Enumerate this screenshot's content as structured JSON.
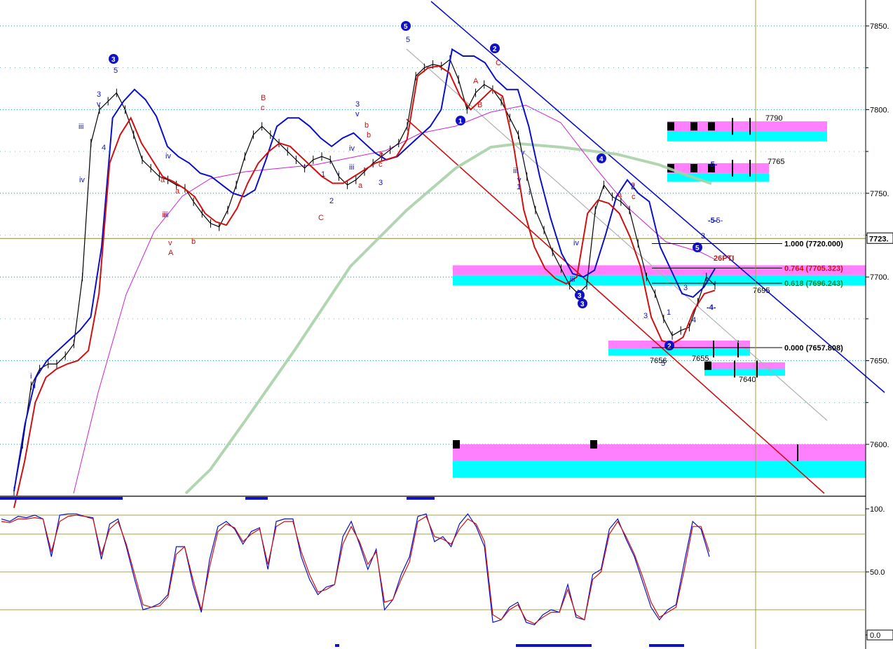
{
  "chart_data": [
    {
      "type": "line",
      "panel": "price",
      "ylim": [
        7580,
        7875
      ],
      "grid": "dotted",
      "y_ticks": [
        "7850.",
        "7800.",
        "7750.",
        "7700.",
        "7650.",
        "7600."
      ],
      "y_tick_values": [
        7850,
        7800,
        7750,
        7700,
        7650,
        7600
      ],
      "current_price_label": "7723.",
      "current_price": 7723,
      "series": [
        {
          "role": "price",
          "color": "#000000",
          "values": [
            7572,
            7600,
            7635,
            7645,
            7648,
            7648,
            7653,
            7660,
            7700,
            7780,
            7800,
            7805,
            7810,
            7800,
            7785,
            7770,
            7765,
            7760,
            7758,
            7755,
            7753,
            7745,
            7738,
            7732,
            7730,
            7740,
            7755,
            7772,
            7785,
            7790,
            7785,
            7780,
            7775,
            7770,
            7765,
            7770,
            7772,
            7770,
            7760,
            7755,
            7758,
            7763,
            7768,
            7772,
            7776,
            7780,
            7790,
            7820,
            7825,
            7827,
            7826,
            7830,
            7818,
            7800,
            7810,
            7815,
            7812,
            7805,
            7795,
            7785,
            7760,
            7740,
            7728,
            7715,
            7705,
            7695,
            7690,
            7695,
            7740,
            7755,
            7748,
            7745,
            7740,
            7720,
            7700,
            7690,
            7675,
            7665,
            7668,
            7670,
            7685,
            7700,
            7695
          ]
        },
        {
          "role": "upper-band",
          "color": "#0a10c8",
          "values": [
            7572,
            7612,
            7640,
            7650,
            7656,
            7662,
            7668,
            7676,
            7718,
            7795,
            7805,
            7812,
            7806,
            7796,
            7778,
            7772,
            7768,
            7762,
            7760,
            7755,
            7750,
            7748,
            7752,
            7770,
            7790,
            7795,
            7795,
            7790,
            7783,
            7778,
            7783,
            7786,
            7780,
            7774,
            7770,
            7772,
            7778,
            7784,
            7790,
            7800,
            7836,
            7832,
            7832,
            7828,
            7818,
            7812,
            7812,
            7790,
            7760,
            7735,
            7714,
            7702,
            7700,
            7704,
            7725,
            7748,
            7758,
            7750,
            7745,
            7718,
            7704,
            7690,
            7688,
            7694,
            7705
          ]
        },
        {
          "role": "lower-band",
          "color": "#d01010",
          "values": [
            7562,
            7590,
            7625,
            7640,
            7645,
            7648,
            7650,
            7656,
            7690,
            7768,
            7785,
            7795,
            7780,
            7770,
            7760,
            7757,
            7753,
            7748,
            7738,
            7733,
            7731,
            7741,
            7756,
            7768,
            7775,
            7780,
            7778,
            7772,
            7766,
            7760,
            7756,
            7756,
            7760,
            7764,
            7768,
            7770,
            7772,
            7782,
            7820,
            7825,
            7826,
            7822,
            7808,
            7800,
            7806,
            7812,
            7808,
            7780,
            7740,
            7718,
            7705,
            7699,
            7696,
            7700,
            7738,
            7746,
            7744,
            7738,
            7724,
            7706,
            7676,
            7662,
            7660,
            7664,
            7680,
            7690,
            7692
          ]
        },
        {
          "role": "moving-average-fast",
          "color": "#d020d0",
          "values": []
        },
        {
          "role": "moving-average-slow",
          "color": "#a8d0a8",
          "values": []
        }
      ],
      "projection_levels": [
        "7790",
        "7765",
        "7695",
        "7655",
        "7640",
        "7656"
      ],
      "fib_levels": [
        {
          "label": "1.000 (7720.000)",
          "value": 7720.0,
          "color": "#000000"
        },
        {
          "label": "0.764 (7705.323)",
          "value": 7705.323,
          "color": "#d01010"
        },
        {
          "label": "0.618 (7696.243)",
          "value": 7696.243,
          "color": "#208020"
        },
        {
          "label": "0.000 (7657.808)",
          "value": 7657.808,
          "color": "#000000"
        }
      ],
      "annotations": [
        "26PTI",
        "-5-",
        "-4-",
        "-5-"
      ],
      "wave_labels": {
        "blue": [
          "3",
          "5",
          "3",
          "v",
          "iii",
          "iv",
          "4",
          "ii",
          "i",
          "iv",
          "iii",
          "1",
          "2",
          "i",
          "iv",
          "3",
          "v",
          "iii",
          "5",
          "5",
          "1",
          "2",
          "iii",
          "v",
          "1",
          "i",
          "iv",
          "iii",
          "3",
          "4",
          "2",
          "-5-",
          "3",
          "5",
          "1",
          "2",
          "5",
          "3",
          "4",
          "3",
          "3",
          "v",
          "3"
        ],
        "red": [
          "B",
          "c",
          "a",
          "b",
          "v",
          "A",
          "iii",
          "b",
          "C",
          "a",
          "b",
          "c",
          "A",
          "B",
          "C",
          "a",
          "c",
          "2",
          "b",
          "a"
        ]
      },
      "colors": {
        "cyan_zone": "#00ffff",
        "magenta_zone": "#ff80ff",
        "blue": "#0a10c8",
        "red": "#d01010"
      }
    },
    {
      "type": "line",
      "panel": "oscillator",
      "ylim": [
        0,
        100
      ],
      "y_ticks": [
        "100.",
        "50.0",
        "0.0"
      ],
      "y_tick_values": [
        100,
        50,
        0
      ],
      "grid_levels": [
        95,
        80,
        50,
        20
      ],
      "series": [
        {
          "role": "fast",
          "color": "#0a10c8",
          "values": [
            92,
            90,
            94,
            93,
            95,
            92,
            62,
            95,
            96,
            96,
            94,
            93,
            60,
            88,
            92,
            70,
            44,
            20,
            22,
            25,
            32,
            70,
            70,
            40,
            18,
            60,
            86,
            90,
            84,
            72,
            82,
            85,
            52,
            90,
            92,
            92,
            62,
            44,
            32,
            38,
            40,
            78,
            90,
            72,
            52,
            68,
            20,
            28,
            48,
            62,
            94,
            96,
            74,
            78,
            70,
            88,
            96,
            86,
            70,
            10,
            12,
            22,
            26,
            10,
            8,
            16,
            20,
            18,
            40,
            14,
            12,
            48,
            52,
            84,
            92,
            76,
            62,
            42,
            22,
            12,
            20,
            24,
            58,
            90,
            84,
            62
          ]
        },
        {
          "role": "slow",
          "color": "#d01010",
          "values": [
            90,
            89,
            92,
            92,
            93,
            92,
            66,
            90,
            94,
            95,
            94,
            92,
            64,
            84,
            90,
            72,
            48,
            24,
            22,
            23,
            30,
            64,
            70,
            44,
            20,
            54,
            82,
            88,
            85,
            74,
            80,
            84,
            56,
            86,
            90,
            90,
            66,
            48,
            34,
            36,
            40,
            72,
            86,
            74,
            56,
            66,
            26,
            28,
            44,
            58,
            90,
            94,
            78,
            76,
            72,
            84,
            92,
            88,
            74,
            16,
            12,
            20,
            24,
            12,
            9,
            14,
            18,
            18,
            36,
            16,
            12,
            44,
            50,
            80,
            90,
            78,
            64,
            46,
            26,
            14,
            18,
            22,
            52,
            86,
            86,
            66
          ]
        }
      ]
    }
  ]
}
